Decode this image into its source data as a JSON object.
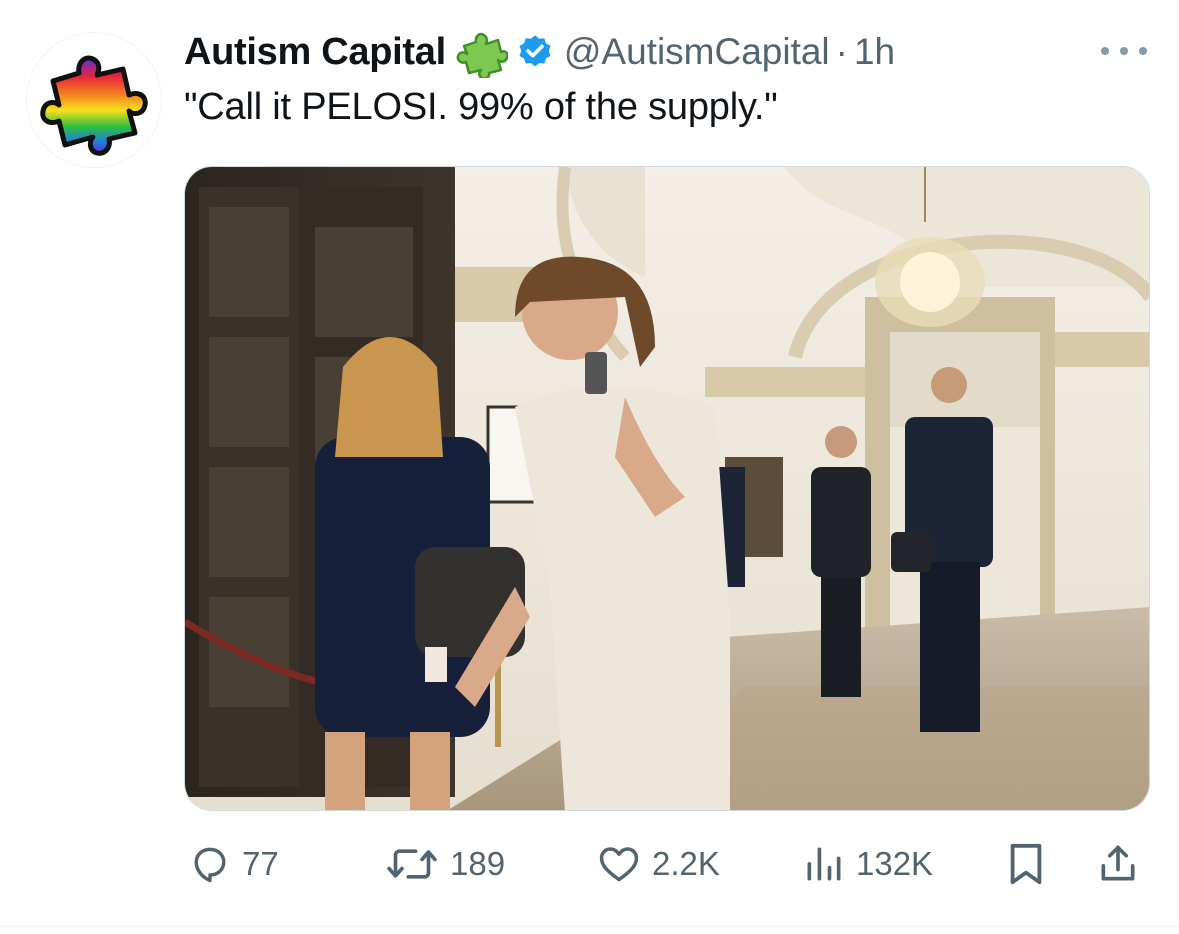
{
  "author": {
    "display_name": "Autism Capital",
    "handle": "@AutismCapital",
    "separator": "·",
    "time": "1h",
    "badge_emoji": "puzzle-piece",
    "verified": true,
    "verified_color": "#1d9bf0"
  },
  "tweet": {
    "text": "\"Call it PELOSI. 99% of the supply.\""
  },
  "media": {
    "description_icon": "photo"
  },
  "actions": {
    "replies": "77",
    "reposts": "189",
    "likes": "2.2K",
    "views": "132K"
  },
  "colors": {
    "text_primary": "#0f1419",
    "text_secondary": "#536471",
    "accent": "#1d9bf0"
  }
}
